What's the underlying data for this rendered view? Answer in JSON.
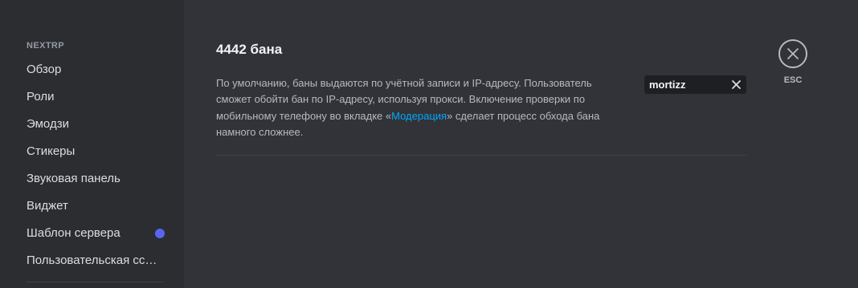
{
  "sidebar": {
    "section_label": "NEXTRP",
    "items": [
      {
        "label": "Обзор"
      },
      {
        "label": "Роли"
      },
      {
        "label": "Эмодзи"
      },
      {
        "label": "Стикеры"
      },
      {
        "label": "Звуковая панель"
      },
      {
        "label": "Виджет"
      },
      {
        "label": "Шаблон сервера"
      },
      {
        "label": "Пользовательская ссылка приглашения"
      }
    ]
  },
  "main": {
    "title": "4442 бана",
    "description": {
      "part1": "По умолчанию, баны выдаются по учётной записи и IP-адресу. Пользователь сможет обойти бан по IP-адресу, используя прокси. Включение проверки по мобильному телефону во вкладке «",
      "link": "Модерация",
      "part2": "» сделает процесс обхода бана намного сложнее."
    },
    "search": {
      "value": "mortizz"
    }
  },
  "close": {
    "label": "ESC"
  },
  "colors": {
    "accent": "#5865f2",
    "link": "#00a8fc",
    "background": "#313338",
    "sidebar": "#2b2d31"
  }
}
